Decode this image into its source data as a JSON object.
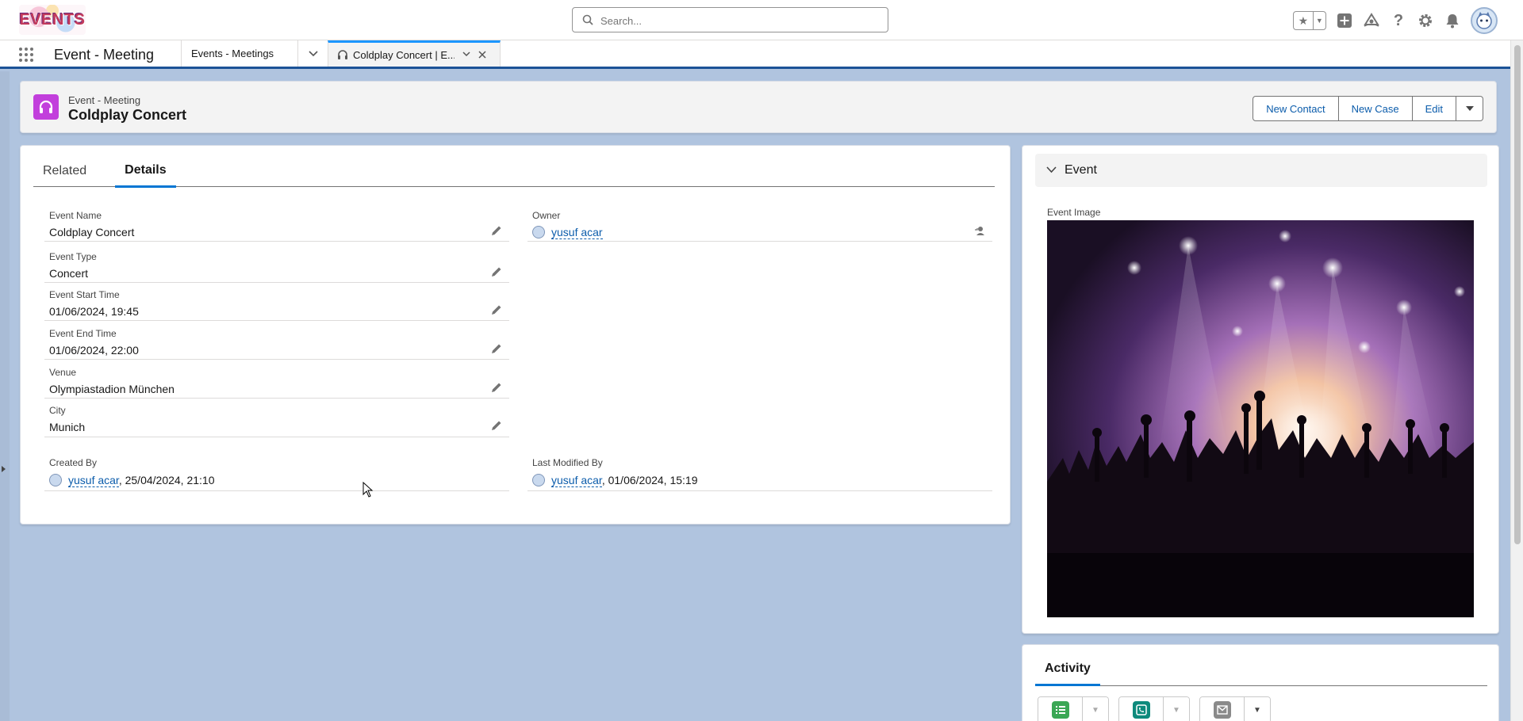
{
  "header": {
    "logo_text": "EVENTS",
    "search_placeholder": "Search...",
    "icons": [
      "favorites-star-icon",
      "add-icon",
      "trailhead-icon",
      "help-icon",
      "setup-gear-icon",
      "notifications-bell-icon",
      "user-avatar"
    ]
  },
  "nav": {
    "app_name": "Event - Meeting",
    "tabs": [
      {
        "label": "Events - Meetings"
      },
      {
        "label": "Coldplay Concert | E...",
        "active": true
      }
    ]
  },
  "record": {
    "type": "Event - Meeting",
    "title": "Coldplay Concert",
    "actions": [
      "New Contact",
      "New Case",
      "Edit"
    ]
  },
  "details": {
    "tabs": [
      "Related",
      "Details"
    ],
    "active_tab": "Details",
    "fields": {
      "event_name": {
        "label": "Event Name",
        "value": "Coldplay Concert"
      },
      "owner": {
        "label": "Owner",
        "value": "yusuf acar"
      },
      "event_type": {
        "label": "Event Type",
        "value": "Concert"
      },
      "start_time": {
        "label": "Event Start Time",
        "value": "01/06/2024, 19:45"
      },
      "end_time": {
        "label": "Event End Time",
        "value": "01/06/2024, 22:00"
      },
      "venue": {
        "label": "Venue",
        "value": "Olympiastadion München"
      },
      "city": {
        "label": "City",
        "value": "Munich"
      },
      "created_by": {
        "label": "Created By",
        "user": "yusuf acar",
        "date": ", 25/04/2024, 21:10"
      },
      "last_modified_by": {
        "label": "Last Modified By",
        "user": "yusuf acar",
        "date": ", 01/06/2024, 15:19"
      }
    }
  },
  "side": {
    "section_title": "Event",
    "image_label": "Event Image"
  },
  "activity": {
    "tab": "Activity"
  },
  "colors": {
    "brand_blue": "#0176d3",
    "link": "#0b5cab",
    "record_icon": "#c23fdc",
    "page_bg": "#b0c4df"
  }
}
